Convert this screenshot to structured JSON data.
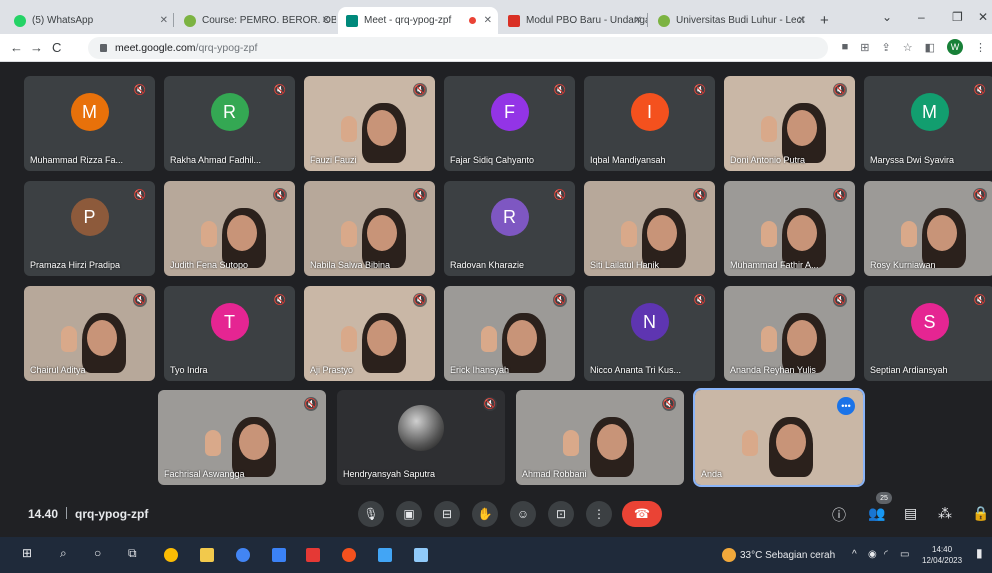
{
  "browser": {
    "tabs": [
      {
        "title": "(5) WhatsApp",
        "color": "#25d366"
      },
      {
        "title": "Course: PEMRO. BEROR. OBY",
        "color": "#7cb342"
      },
      {
        "title": "Meet - qrq-ypog-zpf",
        "color": "#00897b"
      },
      {
        "title": "",
        "color": "#ea4335"
      },
      {
        "title": "Modul PBO Baru - Undangan",
        "color": "#d93025"
      },
      {
        "title": "Universitas Budi Luhur - Lect",
        "color": "#7cb342"
      }
    ],
    "new_tab": "+",
    "url_host": "meet.google.com",
    "url_path": "/qrq-ypog-zpf",
    "profile_initial": "W"
  },
  "participants": [
    {
      "name": "Muhammad Rizza Fa...",
      "initial": "M",
      "color": "#e8710a"
    },
    {
      "name": "Rakha Ahmad Fadhil...",
      "initial": "R",
      "color": "#34a853"
    },
    {
      "name": "Fauzi Fauzi",
      "initial": "",
      "color": ""
    },
    {
      "name": "Fajar Sidiq Cahyanto",
      "initial": "F",
      "color": "#9334e6"
    },
    {
      "name": "Iqbal Mandiyansah",
      "initial": "I",
      "color": "#f4511e"
    },
    {
      "name": "Doni Antonio Putra",
      "initial": "",
      "color": ""
    },
    {
      "name": "Maryssa Dwi Syavira",
      "initial": "M",
      "color": "#129e6f"
    },
    {
      "name": "Pramaza Hirzi Pradipa",
      "initial": "P",
      "color": "#8d5a3b"
    },
    {
      "name": "Judith Fena Sutopo",
      "initial": "",
      "color": ""
    },
    {
      "name": "Nabila Salwa Bibina",
      "initial": "",
      "color": ""
    },
    {
      "name": "Radovan Kharazie",
      "initial": "R",
      "color": "#7e57c2"
    },
    {
      "name": "Siti Lailatul Hanik",
      "initial": "",
      "color": ""
    },
    {
      "name": "Muhammad Fathir A...",
      "initial": "",
      "color": ""
    },
    {
      "name": "Rosy Kurniawan",
      "initial": "",
      "color": ""
    },
    {
      "name": "Chairul Aditya",
      "initial": "",
      "color": ""
    },
    {
      "name": "Tyo Indra",
      "initial": "T",
      "color": "#e52592"
    },
    {
      "name": "Aji Prastyo",
      "initial": "",
      "color": ""
    },
    {
      "name": "Erick Ihansyah",
      "initial": "",
      "color": ""
    },
    {
      "name": "Nicco Ananta Tri Kus...",
      "initial": "N",
      "color": "#5e35b1"
    },
    {
      "name": "Ananda Reyhan Yulis",
      "initial": "",
      "color": ""
    },
    {
      "name": "Septian Ardiansyah",
      "initial": "S",
      "color": "#e52592"
    },
    {
      "name": "Fachrisal Aswangga",
      "initial": "",
      "color": ""
    },
    {
      "name": "Hendryansyah Saputra",
      "initial": "",
      "color": ""
    },
    {
      "name": "Ahmad Robbani",
      "initial": "",
      "color": ""
    },
    {
      "name": "Anda",
      "initial": "",
      "color": ""
    }
  ],
  "meeting": {
    "time": "14.40",
    "code": "qrq-ypog-zpf",
    "participant_count": "25"
  },
  "taskbar": {
    "weather": "33°C  Sebagian cerah",
    "time": "14:40",
    "date": "12/04/2023"
  }
}
